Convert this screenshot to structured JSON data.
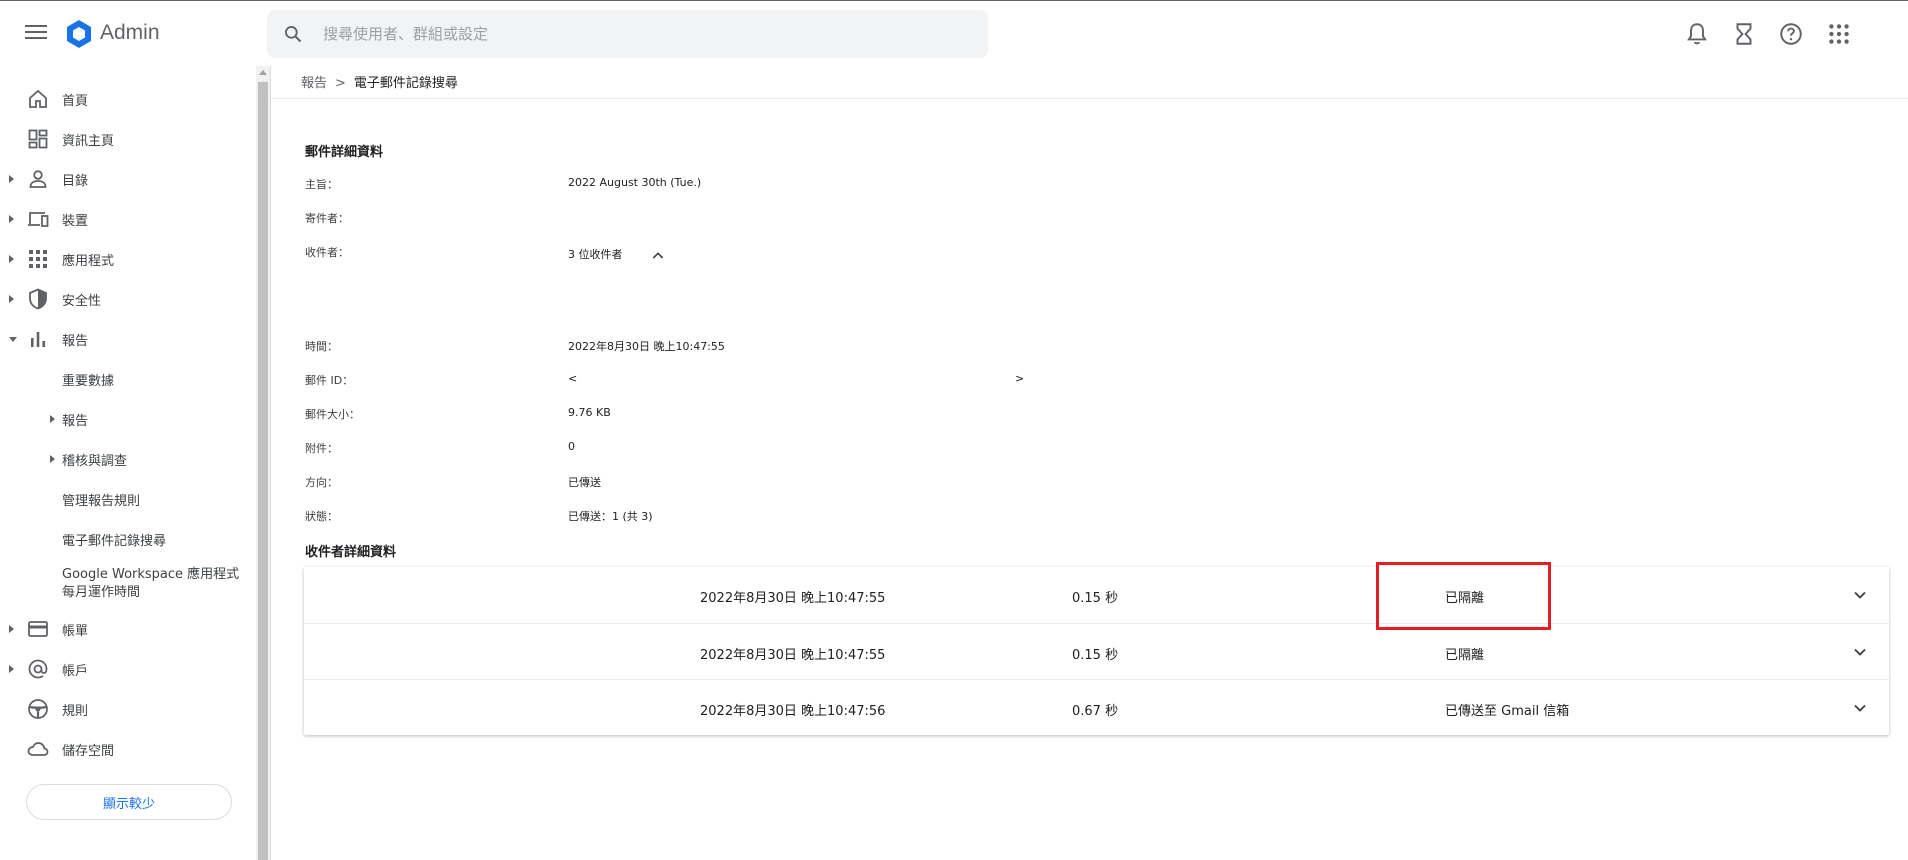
{
  "header": {
    "brand": "Admin",
    "search_placeholder": "搜尋使用者、群組或設定"
  },
  "icons": {
    "menu": "hamburger-menu-icon",
    "logo": "admin-hexagon-logo",
    "search": "search-icon",
    "notifications": "bell-icon",
    "tasks": "hourglass-icon",
    "help": "help-icon",
    "apps": "apps-grid-icon"
  },
  "colors": {
    "accent": "#1a73e8",
    "highlight": "#e21f26",
    "logo": "#1a73e8"
  },
  "sidebar": {
    "items": [
      {
        "label": "首頁",
        "icon": "home-icon"
      },
      {
        "label": "資訊主頁",
        "icon": "dashboard-icon"
      },
      {
        "label": "目錄",
        "icon": "person-icon"
      },
      {
        "label": "裝置",
        "icon": "devices-icon"
      },
      {
        "label": "應用程式",
        "icon": "apps-icon"
      },
      {
        "label": "安全性",
        "icon": "shield-icon"
      },
      {
        "label": "報告",
        "icon": "bar-chart-icon"
      }
    ],
    "report_sub": [
      {
        "label": "重要數據"
      },
      {
        "label": "報告"
      },
      {
        "label": "稽核與調查"
      },
      {
        "label": "管理報告規則"
      },
      {
        "label": "電子郵件記錄搜尋"
      }
    ],
    "workspace_line1": "Google Workspace 應用程式",
    "workspace_line2": "每月運作時間",
    "bottom_items": [
      {
        "label": "帳單",
        "icon": "credit-card-icon"
      },
      {
        "label": "帳戶",
        "icon": "at-sign-icon"
      },
      {
        "label": "規則",
        "icon": "rules-wheel-icon"
      },
      {
        "label": "儲存空間",
        "icon": "cloud-icon"
      }
    ],
    "show_less": "顯示較少"
  },
  "breadcrumb": {
    "parent": "報告",
    "separator": ">",
    "current": "電子郵件記錄搜尋"
  },
  "mail": {
    "title": "郵件詳細資料",
    "subject_label": "主旨：",
    "subject_value": "2022 August 30th (Tue.)",
    "sender_label": "寄件者：",
    "recipients_label": "收件者：",
    "recipients_value": "3 位收件者",
    "time_label": "時間：",
    "time_value": "2022年8月30日 晚上10:47:55",
    "id_label": "郵件 ID：",
    "id_open": "<",
    "id_close": ">",
    "size_label": "郵件大小：",
    "size_value": "9.76 KB",
    "attach_label": "附件：",
    "attach_value": "0",
    "direction_label": "方向：",
    "direction_value": "已傳送",
    "status_label": "狀態：",
    "status_value": "已傳送：1 (共 3)"
  },
  "recipients": {
    "title": "收件者詳細資料",
    "rows": [
      {
        "time": "2022年8月30日 晚上10:47:55",
        "latency": "0.15 秒",
        "status": "已隔離"
      },
      {
        "time": "2022年8月30日 晚上10:47:55",
        "latency": "0.15 秒",
        "status": "已隔離"
      },
      {
        "time": "2022年8月30日 晚上10:47:56",
        "latency": "0.67 秒",
        "status": "已傳送至 Gmail 信箱"
      }
    ]
  }
}
